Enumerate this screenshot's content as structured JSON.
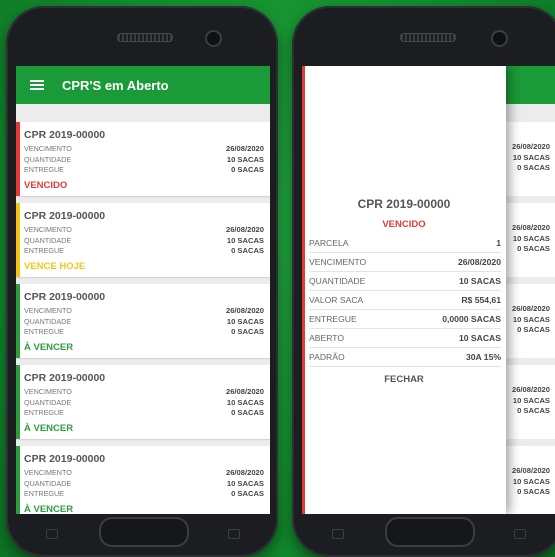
{
  "colors": {
    "green": "#1a9a38",
    "red": "#e53935",
    "yellow": "#f2c618",
    "status_green": "#2e9e3c"
  },
  "app": {
    "title": "CPR'S em Aberto",
    "menu_icon": "hamburger-menu-icon"
  },
  "labels": {
    "vencimento": "VENCIMENTO",
    "quantidade": "QUANTIDADE",
    "entregue": "ENTREGUE"
  },
  "cards": [
    {
      "title": "CPR 2019-00000",
      "vencimento": "26/08/2020",
      "quantidade": "10 SACAS",
      "entregue": "0 SACAS",
      "status": "VENCIDO",
      "status_color": "#e53935"
    },
    {
      "title": "CPR 2019-00000",
      "vencimento": "26/08/2020",
      "quantidade": "10 SACAS",
      "entregue": "0 SACAS",
      "status": "VENCE HOJE",
      "status_color": "#f2c618"
    },
    {
      "title": "CPR 2019-00000",
      "vencimento": "26/08/2020",
      "quantidade": "10 SACAS",
      "entregue": "0 SACAS",
      "status": "À VENCER",
      "status_color": "#2e9e3c"
    },
    {
      "title": "CPR 2019-00000",
      "vencimento": "26/08/2020",
      "quantidade": "10 SACAS",
      "entregue": "0 SACAS",
      "status": "À VENCER",
      "status_color": "#2e9e3c"
    },
    {
      "title": "CPR 2019-00000",
      "vencimento": "26/08/2020",
      "quantidade": "10 SACAS",
      "entregue": "0 SACAS",
      "status": "À VENCER",
      "status_color": "#2e9e3c"
    }
  ],
  "dialog": {
    "title": "CPR 2019-00000",
    "status": "VENCIDO",
    "rows": [
      {
        "label": "PARCELA",
        "value": "1"
      },
      {
        "label": "VENCIMENTO",
        "value": "26/08/2020"
      },
      {
        "label": "QUANTIDADE",
        "value": "10 SACAS"
      },
      {
        "label": "VALOR SACA",
        "value": "R$ 554,61"
      },
      {
        "label": "ENTREGUE",
        "value": "0,0000 SACAS"
      },
      {
        "label": "ABERTO",
        "value": "10 SACAS"
      },
      {
        "label": "PADRÃO",
        "value": "30A 15%"
      }
    ],
    "close_label": "FECHAR"
  }
}
